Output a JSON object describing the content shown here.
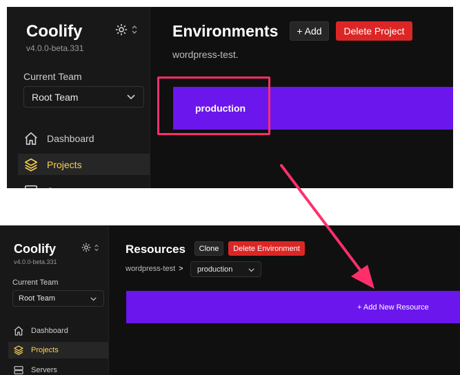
{
  "app": {
    "name": "Coolify",
    "version": "v4.0.0-beta.331"
  },
  "sidebar": {
    "team_label": "Current Team",
    "team_value": "Root Team",
    "items": [
      {
        "label": "Dashboard",
        "icon": "home-icon"
      },
      {
        "label": "Projects",
        "icon": "layers-icon",
        "active": true
      },
      {
        "label": "Servers",
        "icon": "server-icon"
      }
    ]
  },
  "top": {
    "title": "Environments",
    "add_label": "+ Add",
    "delete_label": "Delete Project",
    "subtitle": "wordpress-test.",
    "environment_card": "production"
  },
  "bottom": {
    "title": "Resources",
    "clone_label": "Clone",
    "delete_label": "Delete Environment",
    "breadcrumb_project": "wordpress-test",
    "breadcrumb_sep": ">",
    "environment_select": "production",
    "add_resource_label": "+ Add New Resource"
  },
  "colors": {
    "accent": "#6b16ed",
    "danger": "#dc2626",
    "highlight": "#fe2f6b",
    "active_text": "#fcd452"
  }
}
